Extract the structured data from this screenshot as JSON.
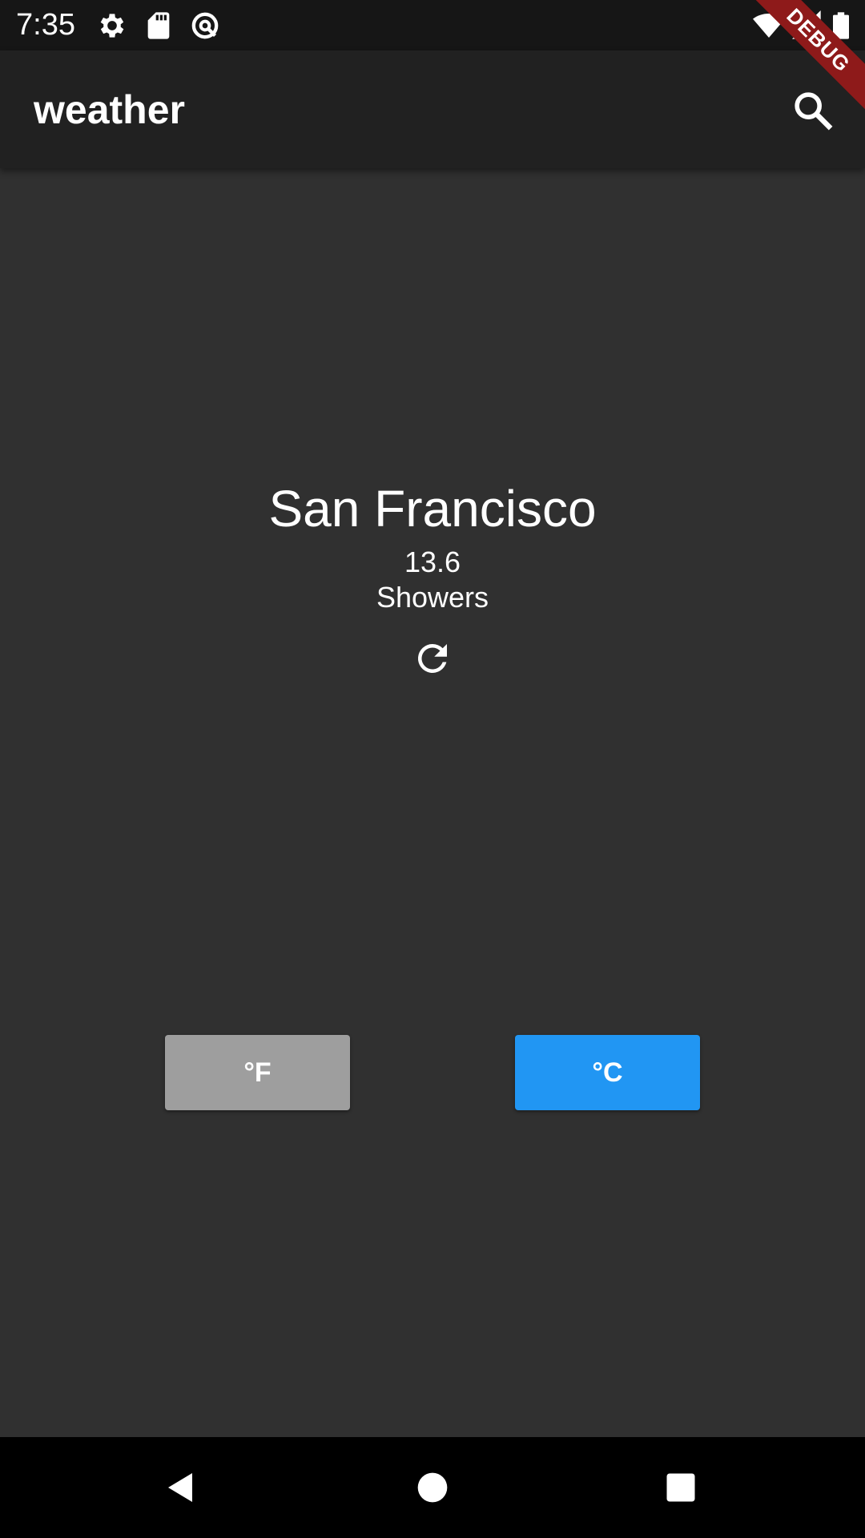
{
  "status_bar": {
    "time": "7:35",
    "icons": [
      "settings-icon",
      "sd-card-icon",
      "data-saver-icon",
      "wifi-icon",
      "cell-signal-icon",
      "battery-icon"
    ]
  },
  "debug_banner": {
    "label": "DEBUG",
    "color": "#8e1a1a"
  },
  "app_bar": {
    "title": "weather",
    "action_icon": "search-icon"
  },
  "weather": {
    "city": "San Francisco",
    "temperature": "13.6",
    "condition": "Showers",
    "refresh_icon": "refresh-icon"
  },
  "units": {
    "fahrenheit": {
      "label": "°F",
      "color": "#9e9e9e",
      "selected": false
    },
    "celsius": {
      "label": "°C",
      "color": "#2196f3",
      "selected": true
    }
  },
  "nav_bar": {
    "icons": [
      "back-icon",
      "home-icon",
      "recents-icon"
    ]
  }
}
